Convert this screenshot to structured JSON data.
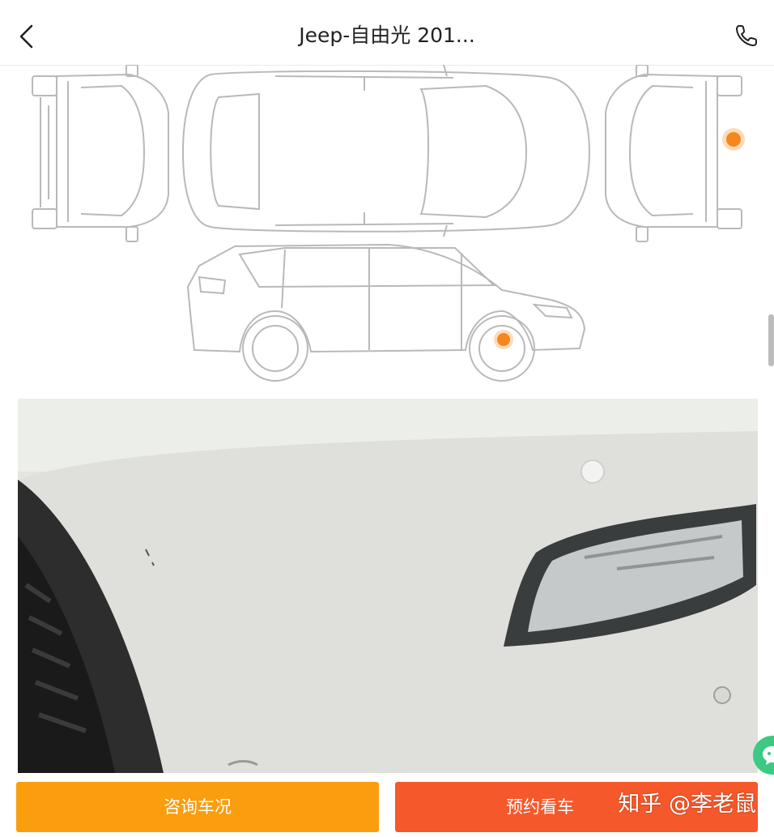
{
  "header": {
    "title": "Jeep-自由光 201...",
    "back_icon": "chevron-left-icon",
    "phone_icon": "phone-icon"
  },
  "diagram": {
    "damage_markers": 2,
    "marker_color": "#f5871f"
  },
  "bottom_bar": {
    "consult_label": "咨询车况",
    "booking_label": "预约看车",
    "consult_color": "#fa9d0e",
    "booking_color": "#f5582b"
  },
  "watermark": {
    "text": "知乎 @李老鼠"
  },
  "floating": {
    "chat_icon": "chat-bubble-icon",
    "color": "#3cc983"
  }
}
